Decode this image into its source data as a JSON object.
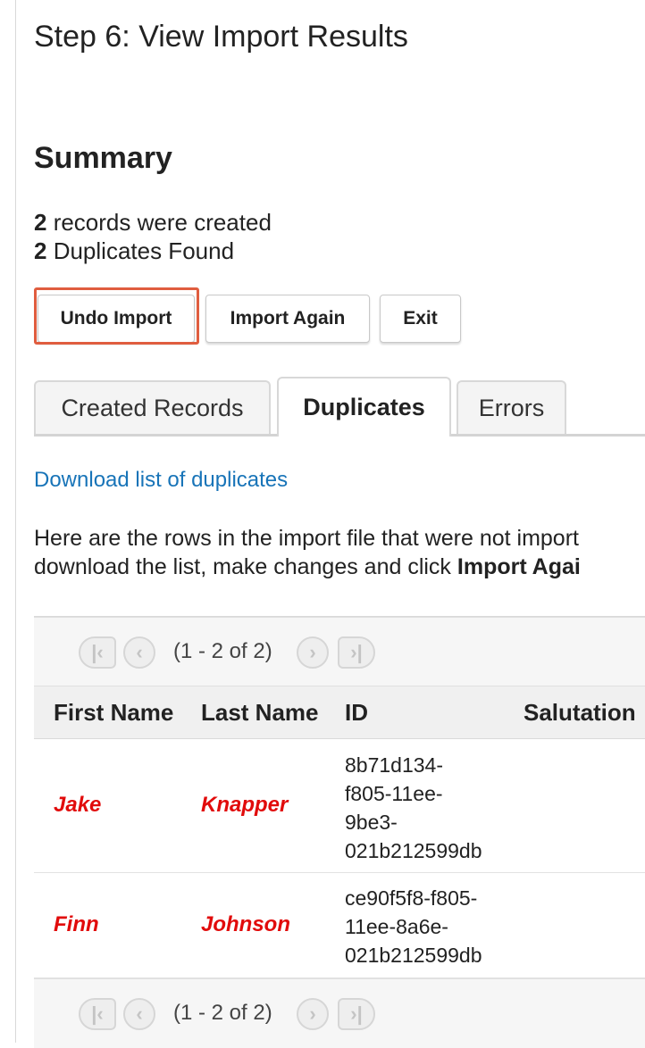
{
  "page": {
    "title": "Step 6: View Import Results"
  },
  "summary": {
    "heading": "Summary",
    "created_count": "2",
    "created_text": " records were created",
    "duplicates_count": "2",
    "duplicates_text": " Duplicates Found"
  },
  "buttons": {
    "undo": "Undo Import",
    "import_again": "Import Again",
    "exit": "Exit"
  },
  "tabs": [
    {
      "label": "Created Records",
      "active": false
    },
    {
      "label": "Duplicates",
      "active": true
    },
    {
      "label": "Errors",
      "active": false
    }
  ],
  "download_link": "Download list of duplicates",
  "description": {
    "line1": "Here are the rows in the import file that were not import",
    "line2_prefix": "download the list, make changes and click ",
    "line2_bold": "Import Agai"
  },
  "pager": {
    "count": "(1 - 2 of 2)",
    "first_icon": "first-page-icon",
    "prev_icon": "previous-page-icon",
    "next_icon": "next-page-icon",
    "last_icon": "last-page-icon"
  },
  "table": {
    "columns": [
      "First Name",
      "Last Name",
      "ID",
      "Salutation"
    ],
    "rows": [
      {
        "first": "Jake",
        "last": "Knapper",
        "id_lines": [
          "8b71d134-",
          "f805-11ee-",
          "9be3-",
          "021b212599db"
        ]
      },
      {
        "first": "Finn",
        "last": "Johnson",
        "id_lines": [
          "ce90f5f8-f805-",
          "11ee-8a6e-",
          "021b212599db"
        ]
      }
    ]
  },
  "colors": {
    "highlight": "#e05d3f",
    "link": "#1874b8",
    "duplicate_name": "#e10b0b"
  }
}
